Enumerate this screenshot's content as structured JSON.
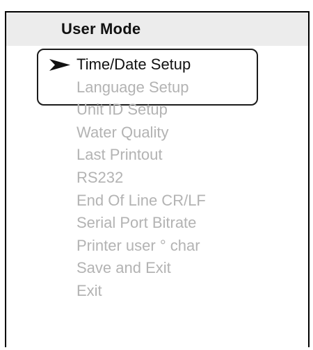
{
  "header": {
    "title": "User Mode"
  },
  "menu": {
    "selected_index": 0,
    "items": [
      {
        "label": "Time/Date Setup"
      },
      {
        "label": "Language Setup"
      },
      {
        "label": "Unit ID Setup"
      },
      {
        "label": "Water Quality"
      },
      {
        "label": "Last Printout"
      },
      {
        "label": "RS232"
      },
      {
        "label": "End Of Line CR/LF"
      },
      {
        "label": "Serial Port Bitrate"
      },
      {
        "label": "Printer user ° char"
      },
      {
        "label": "Save and Exit"
      },
      {
        "label": "Exit"
      }
    ]
  },
  "colors": {
    "selected_text": "#111111",
    "inactive_text": "#b3b3b3",
    "header_bg": "#ececec",
    "border": "#000000"
  },
  "icons": {
    "pointer": "arrowhead-pointer-icon"
  }
}
